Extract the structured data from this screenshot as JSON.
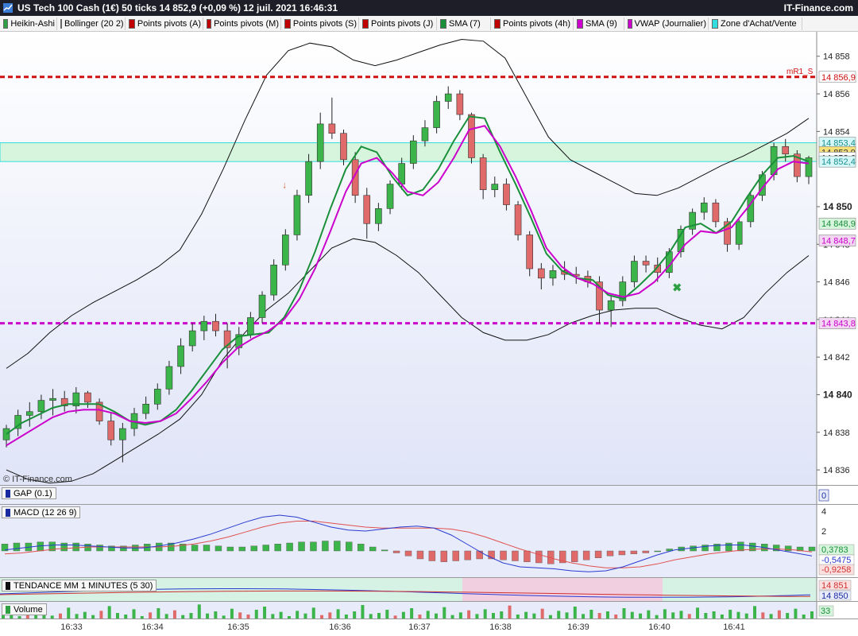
{
  "window": {
    "title": "US Tech 100 Cash (1€) 50 ticks 14 852,9 (+0,09 %) 12 juil. 2021 16:46:31",
    "brand": "IT-Finance.com"
  },
  "toolbar": {
    "items": [
      {
        "label": "Heikin-Ashi",
        "color": "#2ea043"
      },
      {
        "label": "Bollinger (20 2)",
        "color": "#000000"
      },
      {
        "label": "Points pivots (A)",
        "color": "#c00000"
      },
      {
        "label": "Points pivots (M)",
        "color": "#c00000"
      },
      {
        "label": "Points pivots (S)",
        "color": "#c00000"
      },
      {
        "label": "Points pivots (J)",
        "color": "#c00000"
      },
      {
        "label": "SMA (7)",
        "color": "#1a8f3a"
      },
      {
        "label": "Points pivots (4h)",
        "color": "#c00000"
      },
      {
        "label": "SMA (9)",
        "color": "#cc00cc"
      },
      {
        "label": "VWAP (Journalier)",
        "color": "#cc00cc"
      },
      {
        "label": "Zone d'Achat/Vente",
        "color": "#33dddd"
      }
    ]
  },
  "watermark": "© IT-Finance.com",
  "chart_data": [
    {
      "type": "candlestick",
      "title": "US Tech 100 Cash (1€) 50 ticks",
      "style": "Heikin-Ashi",
      "price_axis_ticks": [
        "14 858",
        "14 856",
        "14 854",
        "14 850",
        "14 848",
        "14 846",
        "14 844",
        "14 842",
        "14 840",
        "14 838",
        "14 836"
      ],
      "bold_ticks": [
        "14 850",
        "14 840"
      ],
      "ylim": [
        14835.2,
        14859.3
      ],
      "levels": {
        "mR1_S": {
          "label": "mR1_S",
          "value": 14856.9,
          "text": "14 856,9",
          "color": "#d01010"
        },
        "vwap_line": {
          "value": 14843.8,
          "text": "14 843,8",
          "color": "#cc00cc"
        },
        "zone": {
          "top": 14853.4,
          "bottom": 14852.4,
          "top_text": "14 853,4",
          "bottom_text": "14 852,4",
          "color": "#33dddd"
        },
        "sma7_last": {
          "value": 14852.9,
          "text": "14 852,9"
        },
        "price_last": {
          "value": 14852.6,
          "text": "14 852,6"
        },
        "band_mid": {
          "value": 14848.9,
          "text": "14 848,9"
        },
        "band_other": {
          "value": 14848.7,
          "text": "14 848,7"
        }
      },
      "x_ticks": [
        "16:33",
        "16:34",
        "16:35",
        "16:36",
        "16:37",
        "16:38",
        "16:39",
        "16:40",
        "16:41"
      ],
      "candles": [
        [
          14837.6,
          14838.4,
          14837.2,
          14838.2
        ],
        [
          14838.2,
          14839.2,
          14837.8,
          14838.9
        ],
        [
          14838.9,
          14839.6,
          14838.3,
          14839.1
        ],
        [
          14839.1,
          14840.0,
          14838.7,
          14839.7
        ],
        [
          14839.7,
          14840.3,
          14838.9,
          14839.8
        ],
        [
          14839.8,
          14840.2,
          14839.1,
          14839.4
        ],
        [
          14839.4,
          14840.4,
          14839.0,
          14840.1
        ],
        [
          14840.1,
          14840.2,
          14839.3,
          14839.6
        ],
        [
          14839.6,
          14839.8,
          14838.4,
          14838.6
        ],
        [
          14838.6,
          14839.0,
          14837.3,
          14837.6
        ],
        [
          14837.6,
          14838.5,
          14836.4,
          14838.2
        ],
        [
          14838.2,
          14839.3,
          14837.8,
          14839.0
        ],
        [
          14839.0,
          14839.9,
          14838.7,
          14839.5
        ],
        [
          14839.5,
          14840.6,
          14839.2,
          14840.3
        ],
        [
          14840.3,
          14841.8,
          14840.0,
          14841.5
        ],
        [
          14841.5,
          14843.0,
          14841.1,
          14842.6
        ],
        [
          14842.6,
          14843.8,
          14842.3,
          14843.4
        ],
        [
          14843.4,
          14844.2,
          14842.9,
          14843.9
        ],
        [
          14843.9,
          14844.3,
          14843.1,
          14843.4
        ],
        [
          14843.4,
          14843.8,
          14841.4,
          14842.5
        ],
        [
          14842.5,
          14843.6,
          14842.1,
          14843.2
        ],
        [
          14843.2,
          14844.4,
          14843.0,
          14844.1
        ],
        [
          14844.1,
          14845.5,
          14843.8,
          14845.3
        ],
        [
          14845.3,
          14847.2,
          14845.0,
          14846.9
        ],
        [
          14846.9,
          14848.8,
          14846.6,
          14848.5
        ],
        [
          14848.5,
          14850.9,
          14848.2,
          14850.6
        ],
        [
          14850.6,
          14852.8,
          14850.2,
          14852.4
        ],
        [
          14852.4,
          14855.0,
          14852.0,
          14854.4
        ],
        [
          14854.4,
          14855.8,
          14853.6,
          14853.9
        ],
        [
          14853.9,
          14854.1,
          14852.2,
          14852.5
        ],
        [
          14852.5,
          14852.9,
          14850.2,
          14850.6
        ],
        [
          14850.6,
          14851.0,
          14848.3,
          14849.1
        ],
        [
          14849.1,
          14850.2,
          14848.7,
          14849.9
        ],
        [
          14849.9,
          14851.4,
          14849.6,
          14851.2
        ],
        [
          14851.2,
          14852.6,
          14850.9,
          14852.3
        ],
        [
          14852.3,
          14853.8,
          14852.0,
          14853.5
        ],
        [
          14853.5,
          14854.6,
          14853.2,
          14854.2
        ],
        [
          14854.2,
          14855.9,
          14853.9,
          14855.6
        ],
        [
          14855.6,
          14856.4,
          14855.2,
          14856.0
        ],
        [
          14856.0,
          14856.2,
          14854.6,
          14854.9
        ],
        [
          14854.9,
          14855.0,
          14852.3,
          14852.6
        ],
        [
          14852.6,
          14852.8,
          14850.4,
          14850.9
        ],
        [
          14850.9,
          14851.6,
          14850.5,
          14851.2
        ],
        [
          14851.2,
          14851.5,
          14849.8,
          14850.1
        ],
        [
          14850.1,
          14850.3,
          14848.2,
          14848.5
        ],
        [
          14848.5,
          14848.7,
          14846.3,
          14846.7
        ],
        [
          14846.7,
          14847.0,
          14845.6,
          14846.2
        ],
        [
          14846.2,
          14846.9,
          14845.8,
          14846.6
        ],
        [
          14846.6,
          14847.1,
          14846.1,
          14846.4
        ],
        [
          14846.4,
          14846.8,
          14845.9,
          14846.3
        ],
        [
          14846.3,
          14846.6,
          14845.7,
          14846.0
        ],
        [
          14846.0,
          14846.3,
          14843.8,
          14844.5
        ],
        [
          14844.5,
          14845.3,
          14843.6,
          14845.0
        ],
        [
          14845.0,
          14846.3,
          14844.7,
          14846.0
        ],
        [
          14846.0,
          14847.4,
          14845.7,
          14847.1
        ],
        [
          14847.1,
          14847.4,
          14846.5,
          14846.9
        ],
        [
          14846.9,
          14847.3,
          14846.0,
          14846.5
        ],
        [
          14846.5,
          14847.8,
          14846.2,
          14847.6
        ],
        [
          14847.6,
          14849.0,
          14847.3,
          14848.8
        ],
        [
          14848.8,
          14849.9,
          14848.5,
          14849.7
        ],
        [
          14849.7,
          14850.5,
          14849.3,
          14850.2
        ],
        [
          14850.2,
          14850.4,
          14848.9,
          14849.2
        ],
        [
          14849.2,
          14849.4,
          14847.6,
          14848.0
        ],
        [
          14848.0,
          14849.4,
          14847.7,
          14849.2
        ],
        [
          14849.2,
          14850.8,
          14848.9,
          14850.6
        ],
        [
          14850.6,
          14851.9,
          14850.3,
          14851.7
        ],
        [
          14851.7,
          14853.4,
          14851.4,
          14853.2
        ],
        [
          14853.2,
          14853.6,
          14852.4,
          14852.8
        ],
        [
          14852.8,
          14853.0,
          14851.3,
          14851.6
        ],
        [
          14851.6,
          14852.7,
          14851.2,
          14852.6
        ]
      ],
      "bollinger_upper": [
        14841.4,
        14842.2,
        14843.3,
        14844.2,
        14844.9,
        14845.5,
        14846.1,
        14846.8,
        14847.7,
        14849.6,
        14852.0,
        14854.6,
        14857.0,
        14858.3,
        14858.7,
        14858.5,
        14857.8,
        14857.5,
        14857.8,
        14858.2,
        14858.6,
        14858.9,
        14858.8,
        14857.9,
        14855.8,
        14853.7,
        14852.5,
        14851.9,
        14851.3,
        14850.7,
        14850.6,
        14851.0,
        14851.6,
        14852.2,
        14852.7,
        14853.3,
        14853.9,
        14854.7
      ],
      "bollinger_lower": [
        14836.0,
        14835.5,
        14835.3,
        14835.4,
        14835.8,
        14836.5,
        14837.2,
        14837.9,
        14838.7,
        14840.0,
        14841.9,
        14843.3,
        14844.5,
        14845.4,
        14846.6,
        14847.8,
        14848.3,
        14848.1,
        14847.4,
        14846.5,
        14845.3,
        14844.1,
        14843.3,
        14842.9,
        14842.9,
        14843.2,
        14843.8,
        14844.2,
        14844.5,
        14844.6,
        14844.6,
        14844.1,
        14843.7,
        14843.5,
        14844.1,
        14845.4,
        14846.5,
        14847.4
      ],
      "sma7": [
        14837.9,
        14838.5,
        14838.9,
        14839.3,
        14839.5,
        14839.5,
        14839.5,
        14839.1,
        14838.6,
        14838.4,
        14838.6,
        14839.2,
        14840.2,
        14841.3,
        14842.4,
        14843.1,
        14843.2,
        14843.3,
        14844.1,
        14845.6,
        14847.6,
        14849.9,
        14852.0,
        14853.2,
        14852.9,
        14851.6,
        14850.6,
        14850.9,
        14852.0,
        14853.5,
        14854.8,
        14854.7,
        14852.9,
        14851.2,
        14849.4,
        14847.5,
        14846.6,
        14846.2,
        14846.1,
        14845.3,
        14845.1,
        14845.8,
        14846.6,
        14847.6,
        14848.9,
        14849.1,
        14848.6,
        14849.2,
        14850.5,
        14851.7,
        14852.6,
        14852.7,
        14852.4
      ],
      "sma9": [
        14837.3,
        14837.8,
        14838.3,
        14838.8,
        14839.1,
        14839.2,
        14839.2,
        14839.0,
        14838.6,
        14838.5,
        14838.6,
        14839.0,
        14839.8,
        14840.7,
        14841.7,
        14842.5,
        14843.0,
        14843.4,
        14844.0,
        14845.1,
        14846.7,
        14848.7,
        14850.8,
        14852.3,
        14852.6,
        14851.8,
        14850.8,
        14850.6,
        14851.3,
        14852.6,
        14854.1,
        14854.3,
        14853.2,
        14851.6,
        14849.8,
        14847.8,
        14846.8,
        14846.2,
        14845.9,
        14845.4,
        14845.2,
        14845.4,
        14846.0,
        14846.9,
        14848.0,
        14848.7,
        14848.6,
        14848.9,
        14849.9,
        14851.0,
        14852.0,
        14852.4,
        14852.3
      ]
    },
    {
      "type": "bar",
      "title": "GAP (0.1)",
      "axis_text": "0"
    },
    {
      "type": "bar",
      "title": "MACD (12 26 9)",
      "axis_ticks": [
        "4",
        "2"
      ],
      "last_values": {
        "histogram": "0,3783",
        "macd": "-0,5475",
        "signal": "-0,9258"
      },
      "histogram": [
        0.7,
        0.8,
        0.8,
        0.9,
        0.9,
        0.8,
        0.8,
        0.7,
        0.6,
        0.5,
        0.5,
        0.6,
        0.7,
        0.8,
        0.8,
        0.7,
        0.6,
        0.6,
        0.5,
        0.4,
        0.4,
        0.5,
        0.6,
        0.7,
        0.8,
        0.9,
        0.9,
        1.0,
        1.0,
        0.9,
        0.7,
        0.4,
        0.1,
        -0.2,
        -0.5,
        -0.8,
        -1.0,
        -1.1,
        -1.0,
        -0.9,
        -0.8,
        -0.8,
        -0.9,
        -1.0,
        -1.1,
        -1.2,
        -1.3,
        -1.2,
        -1.1,
        -0.9,
        -0.7,
        -0.5,
        -0.4,
        -0.3,
        -0.2,
        0.0,
        0.2,
        0.4,
        0.5,
        0.6,
        0.7,
        0.8,
        0.9,
        0.8,
        0.7,
        0.6,
        0.5,
        0.4,
        0.4
      ],
      "macd": [
        0.1,
        0.3,
        0.5,
        0.6,
        0.6,
        0.5,
        0.4,
        0.3,
        0.3,
        0.5,
        0.8,
        1.2,
        1.7,
        2.3,
        2.9,
        3.4,
        3.6,
        3.4,
        2.9,
        2.4,
        2.1,
        2.0,
        2.2,
        2.4,
        2.5,
        2.3,
        1.6,
        0.6,
        -0.4,
        -1.2,
        -1.6,
        -1.7,
        -1.8,
        -2.0,
        -2.1,
        -2.0,
        -1.6,
        -1.0,
        -0.4,
        0.1,
        0.3,
        0.5,
        0.6,
        0.6,
        0.4,
        0.1,
        -0.2,
        -0.5
      ],
      "signal": [
        -0.3,
        -0.2,
        0.0,
        0.2,
        0.3,
        0.4,
        0.4,
        0.4,
        0.4,
        0.4,
        0.5,
        0.7,
        1.0,
        1.4,
        1.9,
        2.4,
        2.8,
        3.0,
        3.0,
        2.8,
        2.6,
        2.4,
        2.3,
        2.3,
        2.3,
        2.3,
        2.2,
        1.9,
        1.4,
        0.8,
        0.2,
        -0.3,
        -0.8,
        -1.2,
        -1.5,
        -1.7,
        -1.7,
        -1.6,
        -1.3,
        -0.9,
        -0.6,
        -0.3,
        -0.1,
        0.1,
        0.2,
        0.2,
        0.1,
        -0.1
      ]
    },
    {
      "type": "line",
      "title": "TENDANCE MM 1 MINUTES (5 30)",
      "axis_texts": [
        "14 851",
        "14 850"
      ]
    },
    {
      "type": "bar",
      "title": "Volume",
      "last_value": "33",
      "values": [
        8,
        12,
        6,
        15,
        9,
        18,
        7,
        11,
        22,
        10,
        14,
        8,
        16,
        25,
        12,
        9,
        19,
        6,
        13,
        21,
        10,
        17,
        8,
        12,
        28,
        11,
        15,
        7,
        20,
        13,
        9,
        18,
        24,
        10,
        14,
        6,
        16,
        11,
        22,
        8,
        13,
        19,
        9,
        15,
        27,
        10,
        12,
        18,
        7,
        14,
        21,
        9,
        16,
        11,
        23,
        8,
        13,
        17,
        10,
        19,
        12,
        15,
        26,
        9,
        14,
        11,
        20,
        8,
        16,
        13,
        24,
        10,
        18,
        12,
        15,
        9,
        21,
        14,
        11,
        17,
        8,
        19,
        13,
        16,
        10,
        22,
        12,
        15,
        9,
        18,
        14,
        11,
        25,
        13,
        10,
        17,
        12,
        20,
        9,
        15
      ]
    }
  ]
}
